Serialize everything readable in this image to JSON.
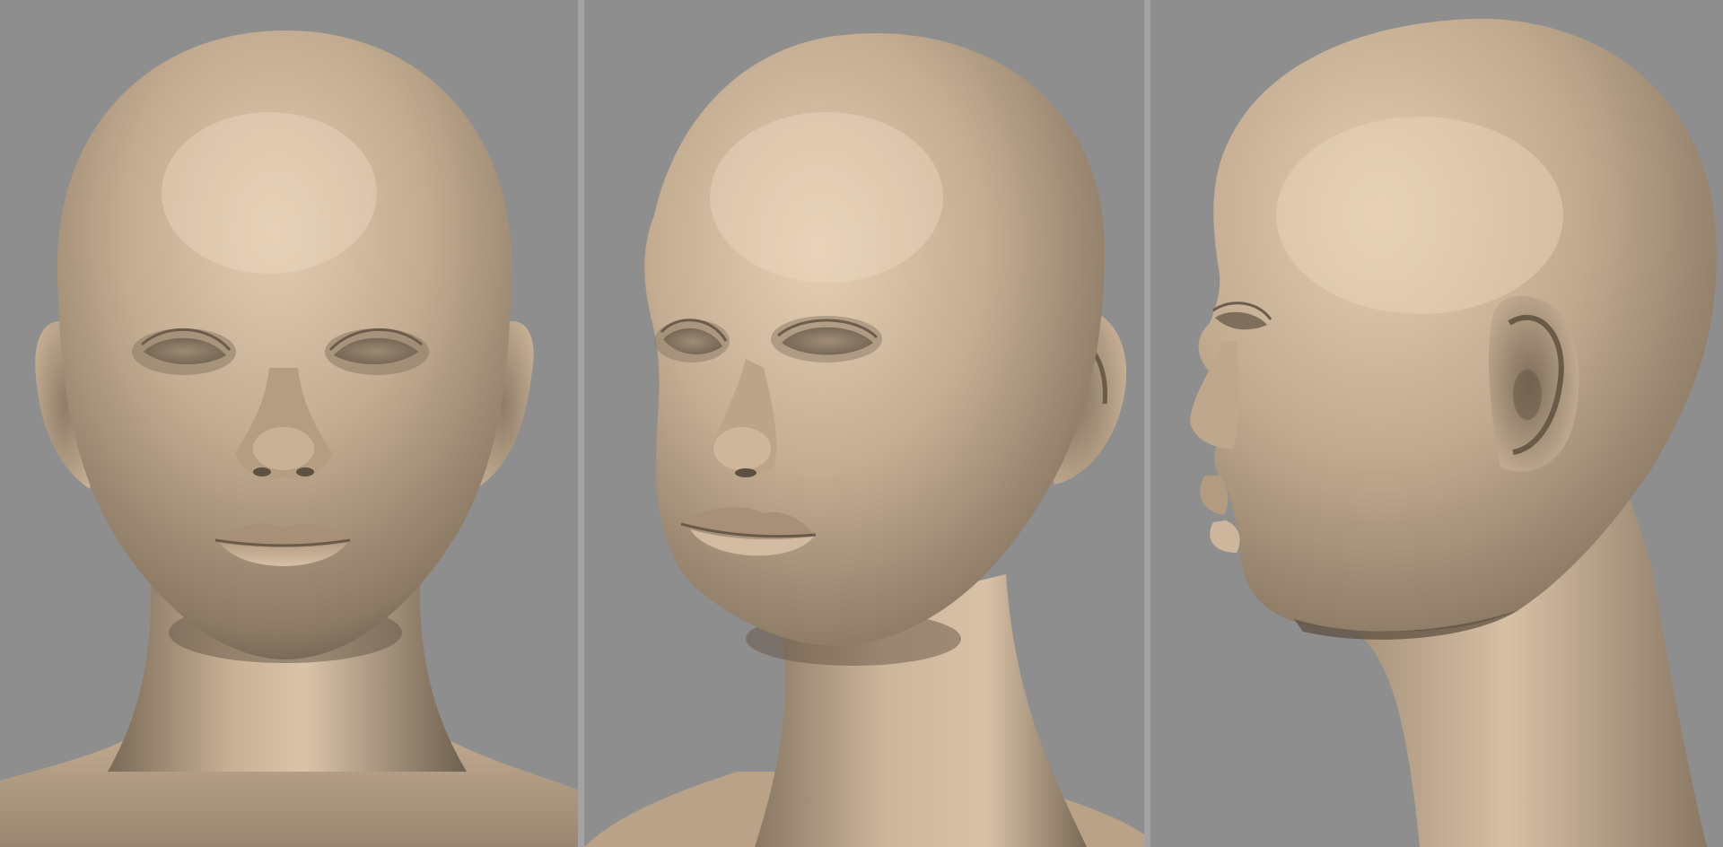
{
  "scene": {
    "background_color": "#8f8f8f",
    "divider_color": "#a3a3a3",
    "clay_base_color": "#b49f86",
    "clay_highlight_color": "#e0cbb1",
    "clay_shadow_color": "#5e5040"
  },
  "views": [
    {
      "id": "front",
      "orientation": "front"
    },
    {
      "id": "three-quarter",
      "orientation": "three-quarter"
    },
    {
      "id": "profile",
      "orientation": "side-profile"
    }
  ]
}
